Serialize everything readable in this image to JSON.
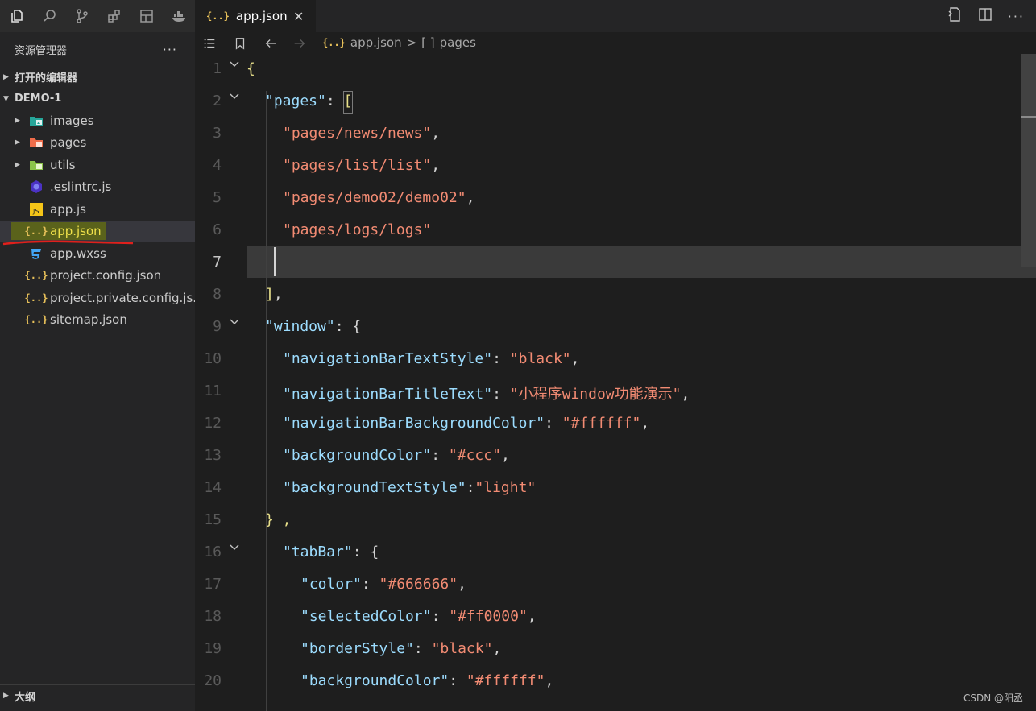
{
  "activity_bar": {
    "icons": [
      "files-icon",
      "search-icon",
      "source-control-icon",
      "extensions-icon",
      "remote-icon",
      "docker-icon"
    ]
  },
  "sidebar": {
    "title": "资源管理器",
    "more": "···",
    "open_editors": "打开的编辑器",
    "project": "DEMO-1",
    "outline": "大纲",
    "items": [
      {
        "label": "images",
        "type": "folder",
        "icon": "image-folder-icon"
      },
      {
        "label": "pages",
        "type": "folder",
        "icon": "pages-folder-icon"
      },
      {
        "label": "utils",
        "type": "folder",
        "icon": "utils-folder-icon"
      },
      {
        "label": ".eslintrc.js",
        "type": "file",
        "icon": "eslint-icon"
      },
      {
        "label": "app.js",
        "type": "file",
        "icon": "js-icon"
      },
      {
        "label": "app.json",
        "type": "file",
        "icon": "json-icon",
        "selected": true
      },
      {
        "label": "app.wxss",
        "type": "file",
        "icon": "css-icon"
      },
      {
        "label": "project.config.json",
        "type": "file",
        "icon": "json-icon"
      },
      {
        "label": "project.private.config.js...",
        "type": "file",
        "icon": "json-icon"
      },
      {
        "label": "sitemap.json",
        "type": "file",
        "icon": "json-icon"
      }
    ]
  },
  "tab": {
    "icon_text": "{..}",
    "label": "app.json",
    "close": "✕"
  },
  "breadcrumb": {
    "file": "app.json",
    "sep": ">",
    "node_icon": "[ ]",
    "node": "pages"
  },
  "editor": {
    "active_line": 7,
    "lines": [
      {
        "n": "1",
        "fold": true
      },
      {
        "n": "2",
        "fold": true
      },
      {
        "n": "3"
      },
      {
        "n": "4"
      },
      {
        "n": "5"
      },
      {
        "n": "6"
      },
      {
        "n": "7"
      },
      {
        "n": "8"
      },
      {
        "n": "9",
        "fold": true
      },
      {
        "n": "10"
      },
      {
        "n": "11"
      },
      {
        "n": "12"
      },
      {
        "n": "13"
      },
      {
        "n": "14"
      },
      {
        "n": "15"
      },
      {
        "n": "16",
        "fold": true
      },
      {
        "n": "17"
      },
      {
        "n": "18"
      },
      {
        "n": "19"
      },
      {
        "n": "20"
      }
    ],
    "tokens": {
      "l1": "{",
      "l2k": "\"pages\"",
      "l2p": ": ",
      "l2b": "[",
      "l3": "\"pages/news/news\"",
      "l3p": ",",
      "l4": "\"pages/list/list\"",
      "l4p": ",",
      "l5": "\"pages/demo02/demo02\"",
      "l5p": ",",
      "l6": "\"pages/logs/logs\"",
      "l8b": "]",
      "l8p": ",",
      "l9k": "\"window\"",
      "l9p": ": {",
      "l10k": "\"navigationBarTextStyle\"",
      "l10p": ": ",
      "l10v": "\"black\"",
      "l10e": ",",
      "l11k": "\"navigationBarTitleText\"",
      "l11p": ": ",
      "l11v": "\"小程序window功能演示\"",
      "l11e": ",",
      "l12k": "\"navigationBarBackgroundColor\"",
      "l12p": ": ",
      "l12v": "\"#ffffff\"",
      "l12e": ",",
      "l13k": "\"backgroundColor\"",
      "l13p": ": ",
      "l13v": "\"#ccc\"",
      "l13e": ",",
      "l14k": "\"backgroundTextStyle\"",
      "l14p": ":",
      "l14v": "\"light\"",
      "l15": "} ,",
      "l16k": "\"tabBar\"",
      "l16p": ": {",
      "l17k": "\"color\"",
      "l17p": ": ",
      "l17v": "\"#666666\"",
      "l17e": ",",
      "l18k": "\"selectedColor\"",
      "l18p": ": ",
      "l18v": "\"#ff0000\"",
      "l18e": ",",
      "l19k": "\"borderStyle\"",
      "l19p": ": ",
      "l19v": "\"black\"",
      "l19e": ",",
      "l20k": "\"backgroundColor\"",
      "l20p": ": ",
      "l20v": "\"#ffffff\"",
      "l20e": ","
    }
  },
  "watermark": "CSDN @阳丞",
  "colors": {
    "key": "#9cdcfe",
    "string": "#f28b73",
    "bracket": "#e8e08a",
    "json_icon": "#e8c15a",
    "annotation_underline": "#e0201c",
    "annotation_highlight": "#7a8700"
  }
}
